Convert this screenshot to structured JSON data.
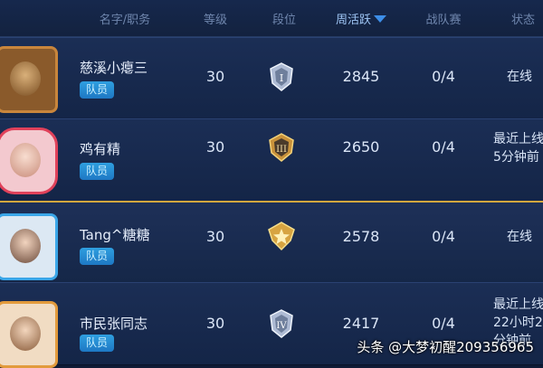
{
  "header": {
    "col_name": "名字/职务",
    "col_level": "等级",
    "col_rank": "段位",
    "col_weekly": "周活跃",
    "col_battle": "战队赛",
    "col_status": "状态"
  },
  "members": [
    {
      "name": "慈溪小瘪三",
      "role": "队员",
      "level": "30",
      "rank_icon": "silver-rank-badge",
      "rank_numeral": "I",
      "weekly": "2845",
      "battle": "0/4",
      "status_1": "在线",
      "status_2": "",
      "status_3": ""
    },
    {
      "name": "鸡有精",
      "role": "队员",
      "level": "30",
      "rank_icon": "gold-rank-badge",
      "rank_numeral": "III",
      "weekly": "2650",
      "battle": "0/4",
      "status_1": "最近上线",
      "status_2": "5分钟前",
      "status_3": ""
    },
    {
      "name": "Tang^糖糖",
      "role": "队员",
      "level": "30",
      "rank_icon": "gold-star-rank-badge",
      "rank_numeral": "",
      "weekly": "2578",
      "battle": "0/4",
      "status_1": "在线",
      "status_2": "",
      "status_3": ""
    },
    {
      "name": "市民张同志",
      "role": "队员",
      "level": "30",
      "rank_icon": "silver-rank-badge",
      "rank_numeral": "IV",
      "weekly": "2417",
      "battle": "0/4",
      "status_1": "最近上线",
      "status_2": "22小时2",
      "status_3": "分钟前"
    }
  ],
  "watermark": "头条 @大梦初醒209356965",
  "colors": {
    "gold_border": "#d3a73e",
    "role_badge": "#2a90d8",
    "sort_arrow": "#3d8ee8",
    "bg": "#0f1b36"
  }
}
